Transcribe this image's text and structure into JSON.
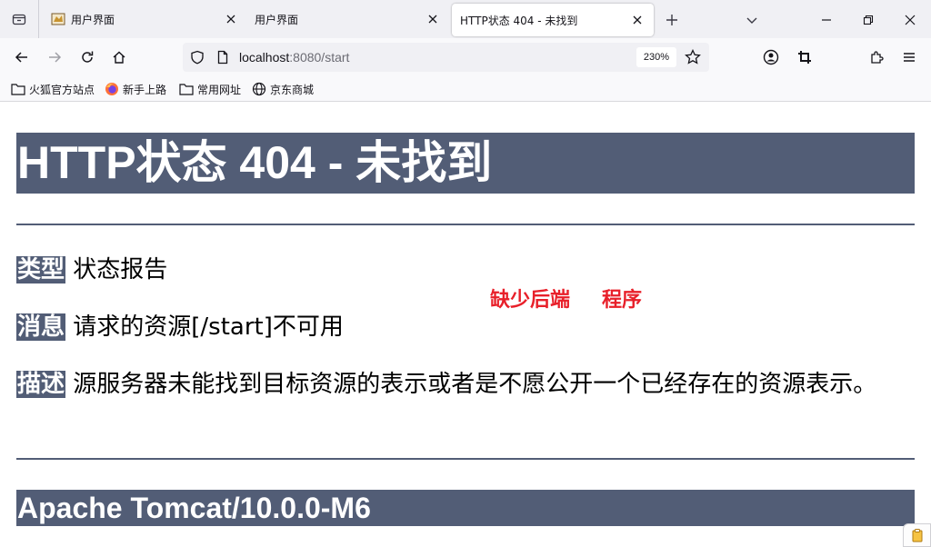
{
  "browser": {
    "tabs": [
      {
        "title": "用户界面",
        "active": false
      },
      {
        "title": "用户界面",
        "active": false
      },
      {
        "title": "HTTP状态 404 - 未找到",
        "active": true
      }
    ],
    "url_host": "localhost",
    "url_path": ":8080/start",
    "zoom": "230%",
    "bookmarks": [
      "火狐官方站点",
      "新手上路",
      "常用网址",
      "京东商城"
    ]
  },
  "page": {
    "title": "HTTP状态 404 - 未找到",
    "type_label": "类型",
    "type_value": "状态报告",
    "message_label": "消息",
    "message_value": "请求的资源[/start]不可用",
    "description_label": "描述",
    "description_value": "源服务器未能找到目标资源的表示或者是不愿公开一个已经存在的资源表示。",
    "server": "Apache Tomcat/10.0.0-M6",
    "annotation_part1": "缺少后端",
    "annotation_part2": "程序"
  },
  "colors": {
    "heading_bg": "#525d76",
    "annotation": "#e8202a"
  }
}
